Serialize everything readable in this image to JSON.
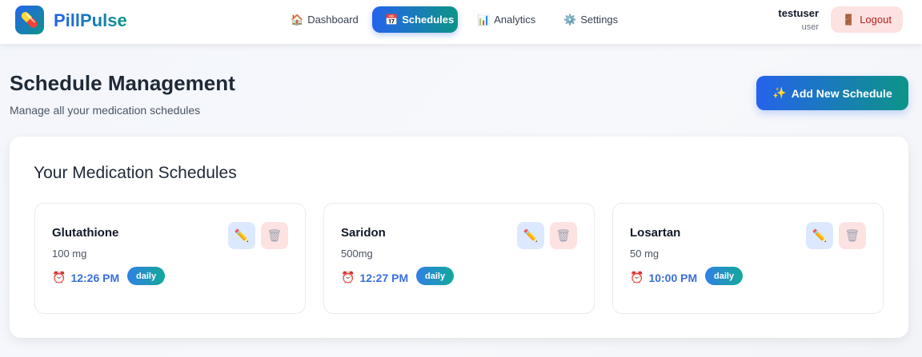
{
  "app": {
    "name": "PillPulse",
    "logo_icon": "💊"
  },
  "nav": [
    {
      "label": "Dashboard",
      "icon": "🏠"
    },
    {
      "label": "Schedules",
      "icon": "📅",
      "active": true
    },
    {
      "label": "Analytics",
      "icon": "📊"
    },
    {
      "label": "Settings",
      "icon": "⚙️"
    }
  ],
  "user": {
    "name": "testuser",
    "role": "user",
    "logout_label": "Logout",
    "logout_icon": "🚪"
  },
  "page": {
    "title": "Schedule Management",
    "subtitle": "Manage all your medication schedules",
    "add_label": "Add New Schedule",
    "add_icon": "✨"
  },
  "panel": {
    "title": "Your Medication Schedules"
  },
  "schedules": [
    {
      "name": "Glutathione",
      "dose": "100 mg",
      "time": "12:26 PM",
      "frequency": "daily"
    },
    {
      "name": "Saridon",
      "dose": "500mg",
      "time": "12:27 PM",
      "frequency": "daily"
    },
    {
      "name": "Losartan",
      "dose": "50 mg",
      "time": "10:00 PM",
      "frequency": "daily"
    }
  ],
  "icons": {
    "alarm": "⏰",
    "edit": "✏️",
    "delete": "🗑"
  }
}
